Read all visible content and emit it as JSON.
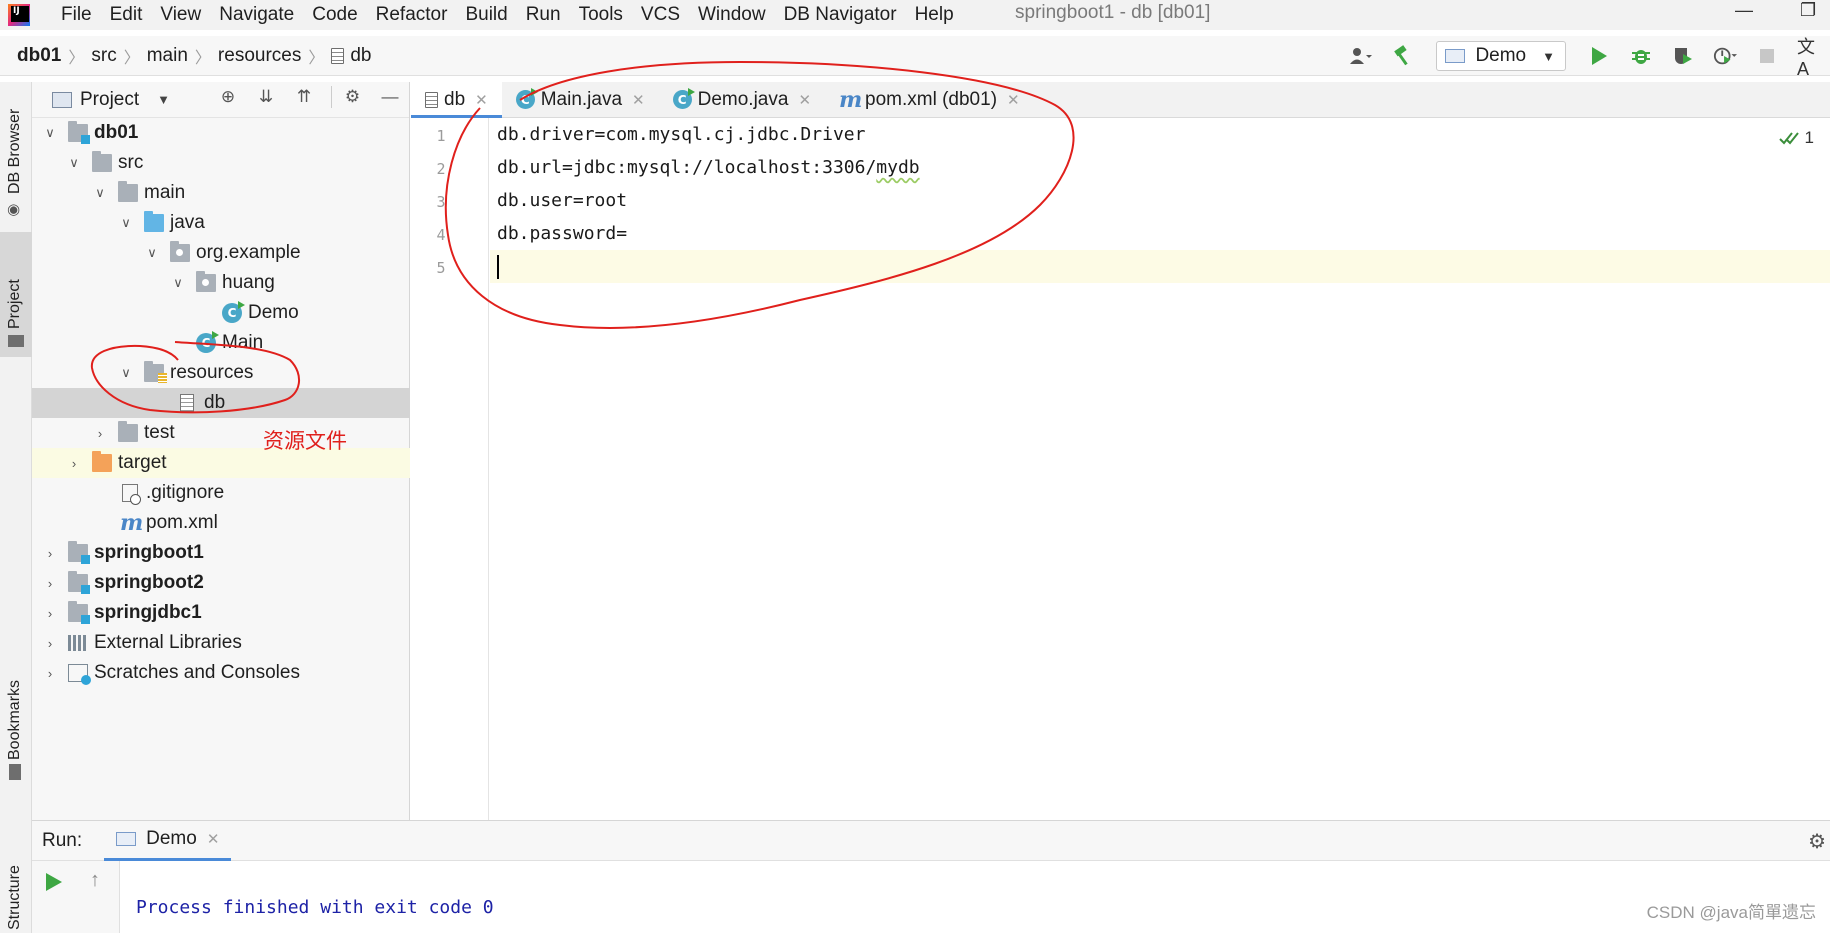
{
  "menubar": {
    "items": [
      "File",
      "Edit",
      "View",
      "Navigate",
      "Code",
      "Refactor",
      "Build",
      "Run",
      "Tools",
      "VCS",
      "Window",
      "DB Navigator",
      "Help"
    ],
    "window_title": "springboot1 - db [db01]"
  },
  "navbar": {
    "breadcrumb": [
      "db01",
      "src",
      "main",
      "resources",
      "db"
    ],
    "run_config": "Demo"
  },
  "left_strip": {
    "tabs": [
      "DB Browser",
      "Project",
      "Bookmarks",
      "Structure"
    ]
  },
  "project_panel": {
    "title": "Project",
    "tree": [
      {
        "label": "db01",
        "depth": 0,
        "expanded": true
      },
      {
        "label": "src",
        "depth": 1,
        "expanded": true
      },
      {
        "label": "main",
        "depth": 2,
        "expanded": true
      },
      {
        "label": "java",
        "depth": 3,
        "expanded": true
      },
      {
        "label": "org.example",
        "depth": 4,
        "expanded": true
      },
      {
        "label": "huang",
        "depth": 5,
        "expanded": true
      },
      {
        "label": "Demo",
        "depth": 6
      },
      {
        "label": "Main",
        "depth": 5
      },
      {
        "label": "resources",
        "depth": 3,
        "expanded": true
      },
      {
        "label": "db",
        "depth": 4,
        "selected": true
      },
      {
        "label": "test",
        "depth": 2,
        "expanded": false
      },
      {
        "label": "target",
        "depth": 1,
        "expanded": false
      },
      {
        "label": ".gitignore",
        "depth": 1
      },
      {
        "label": "pom.xml",
        "depth": 1
      },
      {
        "label": "springboot1",
        "depth": 0,
        "expanded": false
      },
      {
        "label": "springboot2",
        "depth": 0,
        "expanded": false
      },
      {
        "label": "springjdbc1",
        "depth": 0,
        "expanded": false
      },
      {
        "label": "External Libraries",
        "depth": 0,
        "expanded": false
      },
      {
        "label": "Scratches and Consoles",
        "depth": 0,
        "expanded": false
      }
    ]
  },
  "editor": {
    "tabs": [
      {
        "label": "db",
        "active": true
      },
      {
        "label": "Main.java"
      },
      {
        "label": "Demo.java"
      },
      {
        "label": "pom.xml (db01)"
      }
    ],
    "lines": [
      {
        "num": "1",
        "text": "db.driver=com.mysql.cj.jdbc.Driver"
      },
      {
        "num": "2",
        "text_a": "db.url=jdbc:mysql://localhost:3306/",
        "text_b": "mydb"
      },
      {
        "num": "3",
        "text": "db.user=root"
      },
      {
        "num": "4",
        "text": "db.password="
      },
      {
        "num": "5",
        "text": ""
      }
    ],
    "inspection_count": "1"
  },
  "run_panel": {
    "label": "Run:",
    "tab": "Demo",
    "output": "Process finished with exit code 0"
  },
  "annotation": "资源文件",
  "watermark": "CSDN @java简單遗忘",
  "colors": {
    "accent": "#4a8ad8",
    "annotation_red": "#e0201c",
    "run_green": "#3ea743",
    "console_text": "#1d22a6"
  }
}
